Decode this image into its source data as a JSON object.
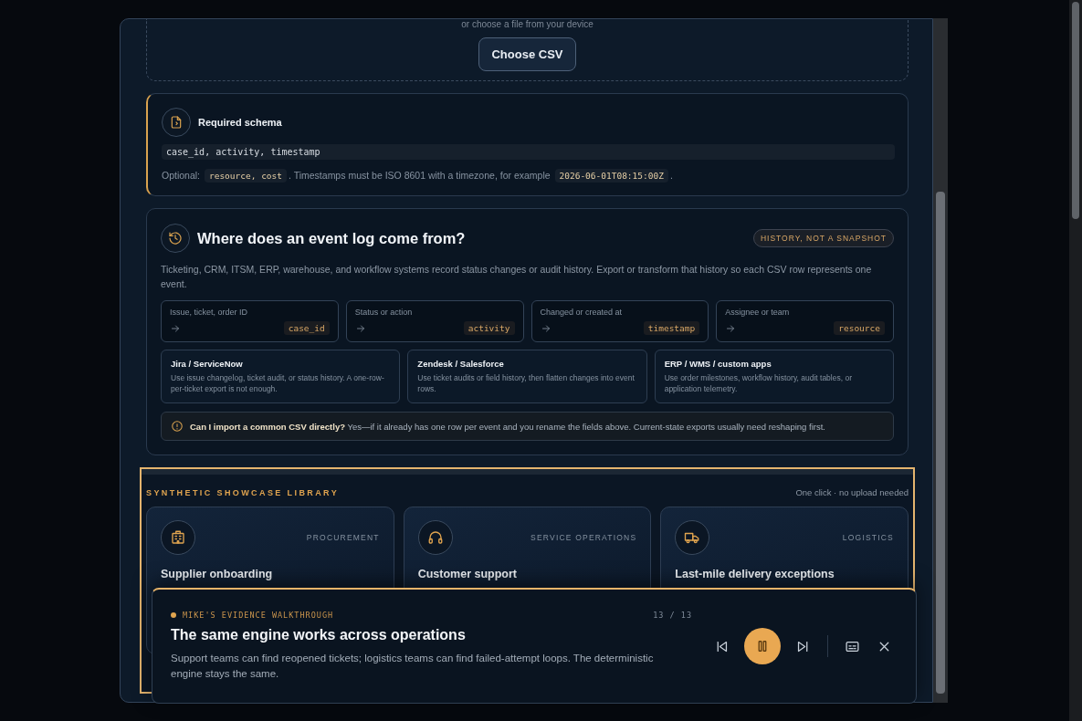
{
  "dropzone": {
    "hint": "or choose a file from your device",
    "button": "Choose CSV"
  },
  "schema": {
    "title": "Required schema",
    "required": "case_id, activity, timestamp",
    "optional_label": "Optional:",
    "optional_fields": "resource, cost",
    "note": ". Timestamps must be ISO 8601 with a timezone, for example",
    "example": "2026-06-01T08:15:00Z",
    "end": "."
  },
  "event_log": {
    "title": "Where does an event log come from?",
    "badge": "HISTORY, NOT A SNAPSHOT",
    "description": "Ticketing, CRM, ITSM, ERP, warehouse, and workflow systems record status changes or audit history. Export or transform that history so each CSV row represents one event.",
    "mappings": [
      {
        "source": "Issue, ticket, order ID",
        "field": "case_id"
      },
      {
        "source": "Status or action",
        "field": "activity"
      },
      {
        "source": "Changed or created at",
        "field": "timestamp"
      },
      {
        "source": "Assignee or team",
        "field": "resource"
      }
    ],
    "systems": [
      {
        "name": "Jira / ServiceNow",
        "text": "Use issue changelog, ticket audit, or status history. A one-row-per-ticket export is not enough."
      },
      {
        "name": "Zendesk / Salesforce",
        "text": "Use ticket audits or field history, then flatten changes into event rows."
      },
      {
        "name": "ERP / WMS / custom apps",
        "text": "Use order milestones, workflow history, audit tables, or application telemetry."
      }
    ],
    "faq": "**Can I import a common CSV directly?** Yes—if it already has one row per event and you rename the fields above. Current-state exports usually need reshaping first."
  },
  "showcase": {
    "title": "SYNTHETIC SHOWCASE LIBRARY",
    "note": "One click · no upload needed",
    "cards": [
      {
        "kind": "building",
        "category": "PROCUREMENT",
        "title": "Supplier onboarding"
      },
      {
        "kind": "headset",
        "category": "SERVICE OPERATIONS",
        "title": "Customer support"
      },
      {
        "kind": "truck",
        "category": "LOGISTICS",
        "title": "Last-mile delivery exceptions"
      }
    ]
  },
  "walkthrough": {
    "label": "MIKE'S EVIDENCE WALKTHROUGH",
    "counter": "13 / 13",
    "title": "The same engine works across operations",
    "text": "Support teams can find reopened tickets; logistics teams can find failed-attempt loops. The deterministic engine stays the same.",
    "playing": true
  }
}
